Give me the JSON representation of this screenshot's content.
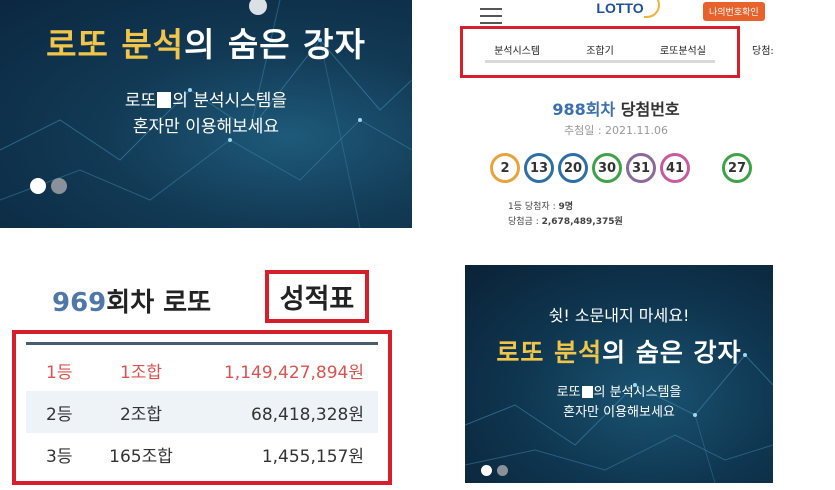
{
  "banner_top_left": {
    "title_gold": "로또 분석",
    "title_white": "의 숨은 강자",
    "sub_line1_a": "로또",
    "sub_line1_b": "의 분석시스템을",
    "sub_line2": "혼자만 이용해보세요"
  },
  "phone": {
    "logo": "LOTTO",
    "my_number_button": "나의번호확인",
    "tabs": [
      "분석시스템",
      "조합기",
      "로또분석실"
    ],
    "tab_extra": "당첨:",
    "round": "988회차",
    "round_suffix": "당첨번호",
    "draw_date": "추첨일 : 2021.11.06",
    "balls": [
      {
        "n": "2",
        "color": "#e8a33c"
      },
      {
        "n": "13",
        "color": "#2e6fa8"
      },
      {
        "n": "20",
        "color": "#2e6fa8"
      },
      {
        "n": "30",
        "color": "#3fa24a"
      },
      {
        "n": "31",
        "color": "#8a6a9a"
      },
      {
        "n": "41",
        "color": "#c95aa0"
      }
    ],
    "bonus_ball": {
      "n": "27",
      "color": "#3fa24a"
    },
    "winners_label": "1등 당첨자 :",
    "winners_value": "9명",
    "prize_label": "당첨금 :",
    "prize_value": "2,678,489,375원"
  },
  "score": {
    "round": "969",
    "round_suffix": "회차 로또",
    "badge": "성적표",
    "rows": [
      {
        "rank": "1등",
        "combo": "1조합",
        "amount": "1,149,427,894원"
      },
      {
        "rank": "2등",
        "combo": "2조합",
        "amount": "68,418,328원"
      },
      {
        "rank": "3등",
        "combo": "165조합",
        "amount": "1,455,157원"
      }
    ]
  },
  "banner_bottom_right": {
    "tagline": "쉿! 소문내지 마세요!",
    "title_gold": "로또 분석",
    "title_white": "의 숨은 강자",
    "sub_line1_a": "로또",
    "sub_line1_b": "의 분석시스템을",
    "sub_line2": "혼자만 이용해보세요"
  }
}
